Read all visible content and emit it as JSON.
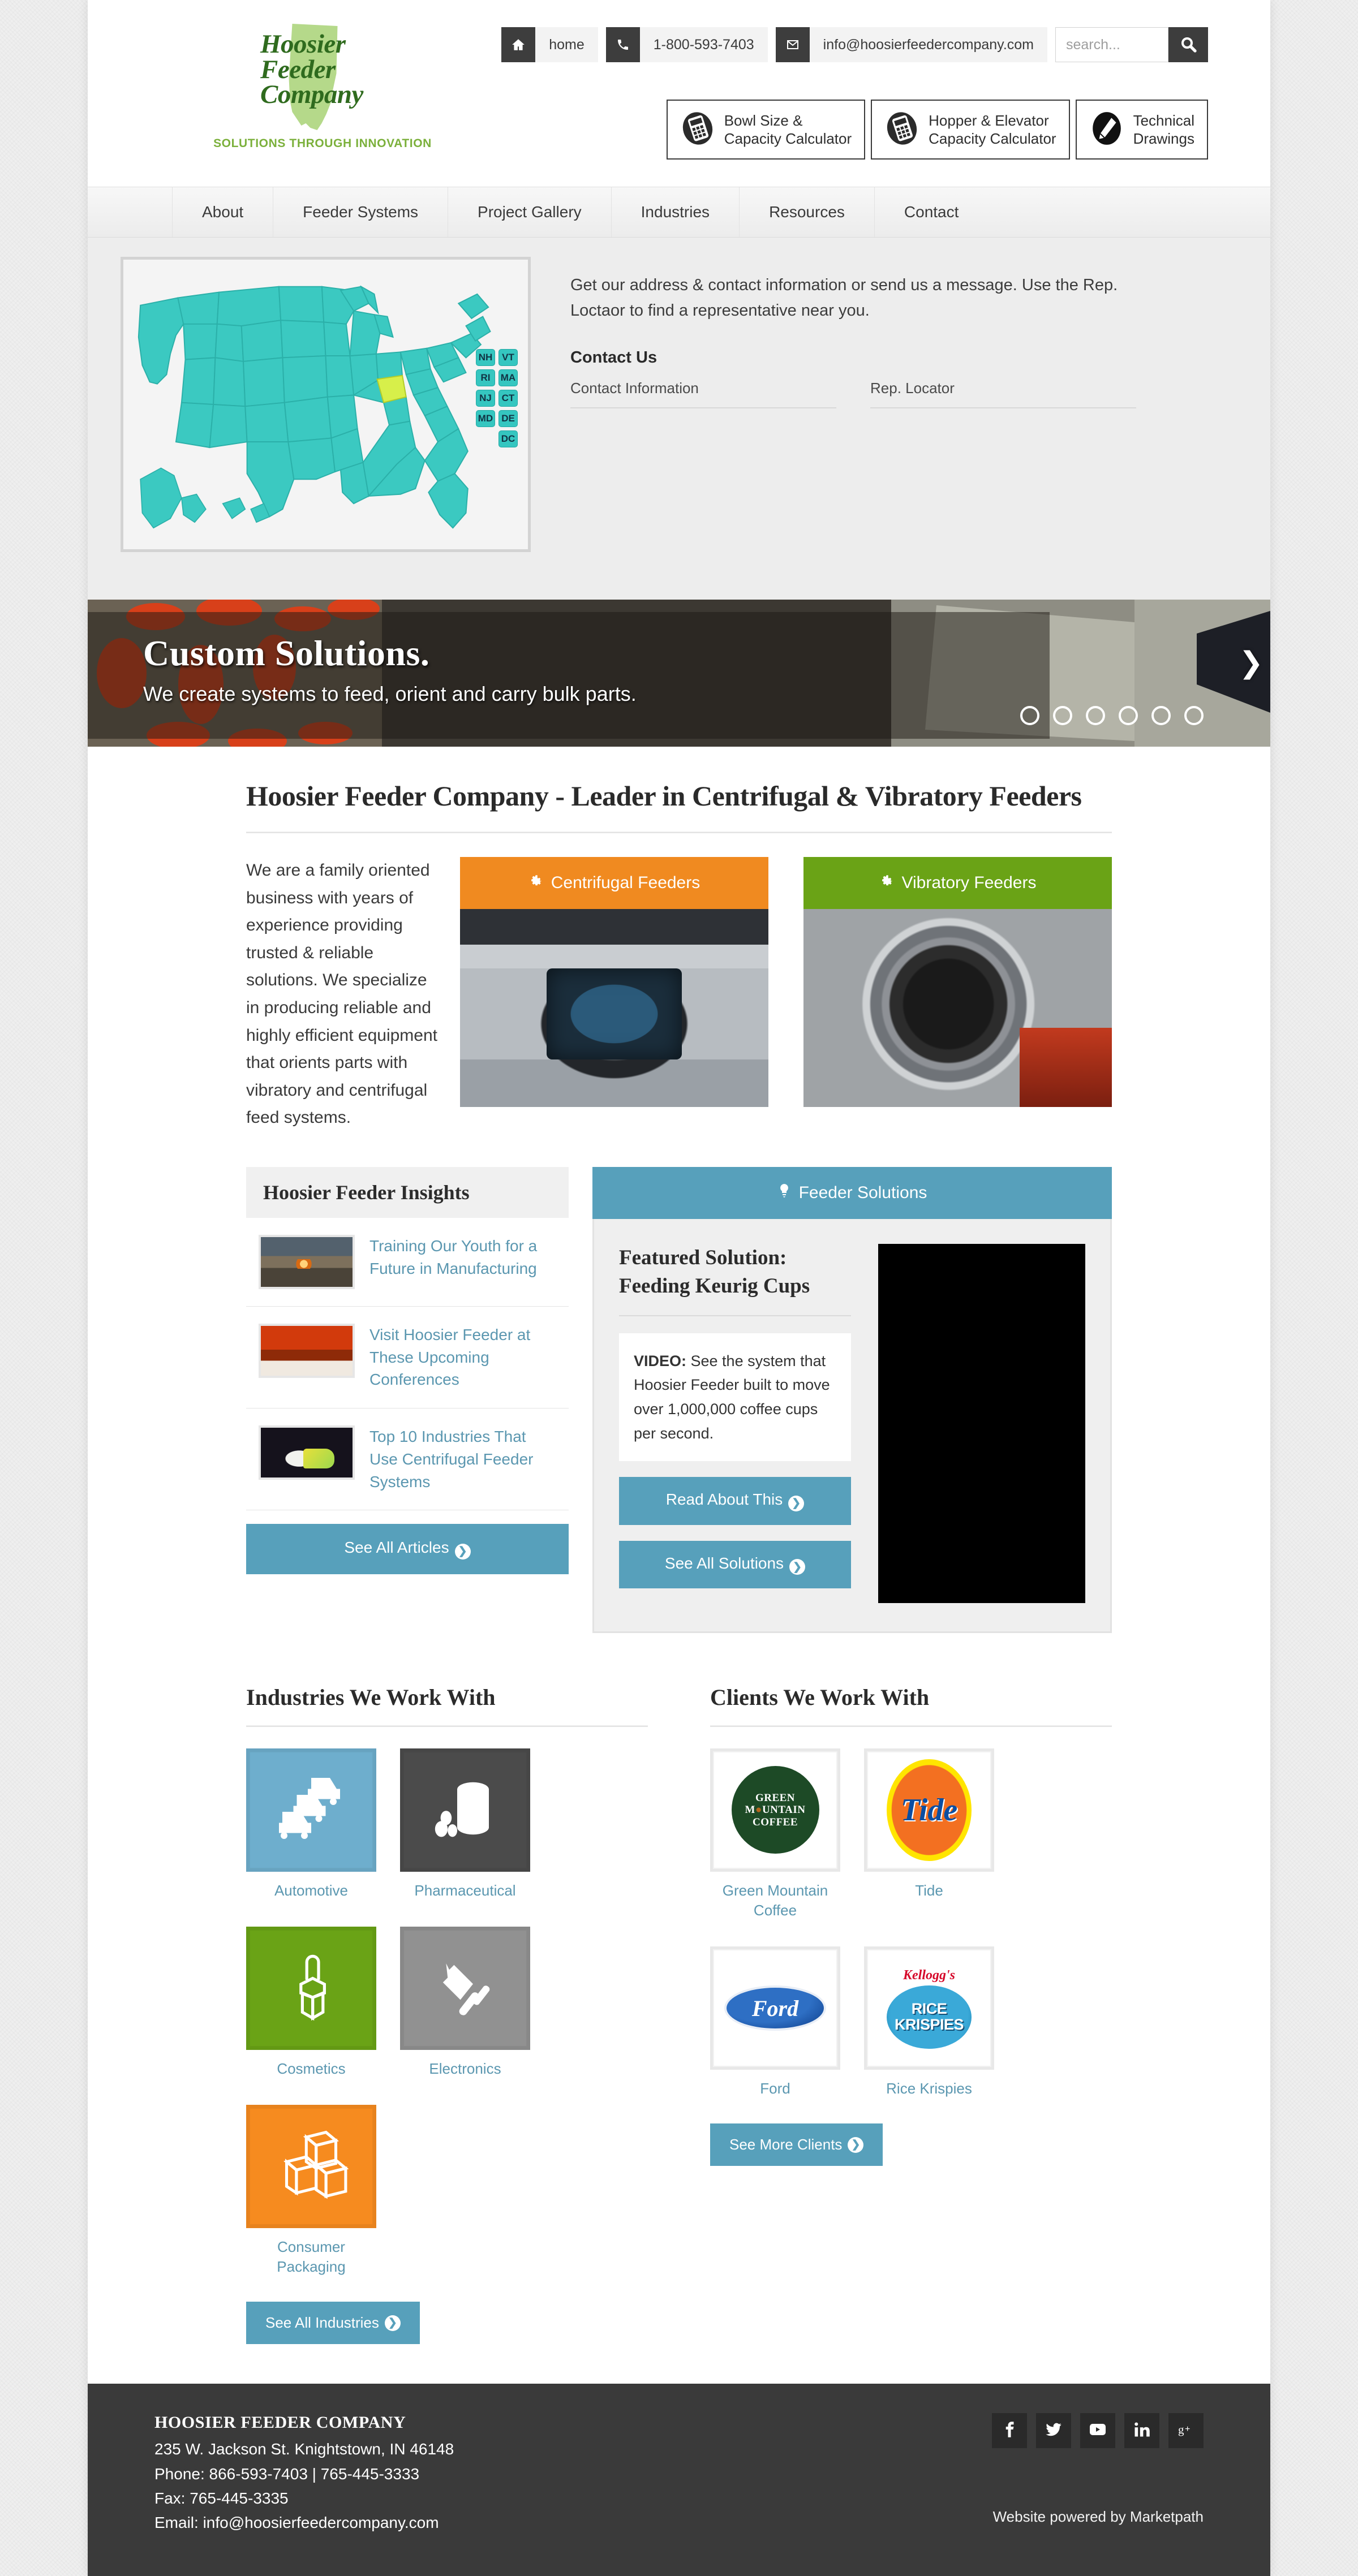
{
  "brand": {
    "name_lines": [
      "Hoosier",
      "Feeder",
      "Company"
    ],
    "tagline": "SOLUTIONS THROUGH INNOVATION",
    "accent_green": "#7bb03b",
    "accent_blue": "#57a0bb"
  },
  "topbar": {
    "home_label": "home",
    "phone": "1-800-593-7403",
    "email": "info@hoosierfeedercompany.com",
    "search_placeholder": "search..."
  },
  "tools": [
    {
      "line1": "Bowl Size &",
      "line2": "Capacity Calculator",
      "icon": "calculator-icon"
    },
    {
      "line1": "Hopper & Elevator",
      "line2": "Capacity Calculator",
      "icon": "calculator-icon"
    },
    {
      "line1": "Technical",
      "line2": "Drawings",
      "icon": "pencil-icon"
    }
  ],
  "nav": {
    "items": [
      "About",
      "Feeder Systems",
      "Project Gallery",
      "Industries",
      "Resources",
      "Contact"
    ]
  },
  "mega": {
    "lead": "Get our address & contact information or send us a message. Use the Rep. Loctaor to find a representative near you.",
    "heading": "Contact Us",
    "links": [
      "Contact Information",
      "Rep. Locator"
    ],
    "map": {
      "highlight_state": "Indiana",
      "map_fill": "#3bc9c1",
      "highlight_fill": "#d7ef4a",
      "chips_left": [
        "NH",
        "RI",
        "NJ",
        "MD"
      ],
      "chips_right": [
        "VT",
        "MA",
        "CT",
        "DE",
        "DC"
      ]
    }
  },
  "hero": {
    "title": "Custom Solutions.",
    "subtitle": "We create systems to feed, orient and carry bulk parts.",
    "slide_count": 6,
    "active_slide": 1
  },
  "main": {
    "page_title": "Hoosier Feeder Company - Leader in Centrifugal & Vibratory Feeders",
    "intro": "We are a family oriented business with years of experience providing trusted & reliable solutions. We specialize in producing reliable and highly efficient equipment that orients parts with vibratory and centrifugal feed systems.",
    "feeder_cards": [
      {
        "label": "Centrifugal Feeders",
        "color": "#f08a20",
        "icon": "gear-icon"
      },
      {
        "label": "Vibratory Feeders",
        "color": "#6aa316",
        "icon": "gear-icon"
      }
    ]
  },
  "insights": {
    "heading": "Hoosier Feeder Insights",
    "articles": [
      {
        "title": "Training Our Youth for a Future in Manufacturing"
      },
      {
        "title": "Visit Hoosier Feeder at These Upcoming Conferences"
      },
      {
        "title": "Top 10 Industries That Use Centrifugal Feeder Systems"
      }
    ],
    "see_all_label": "See All Articles"
  },
  "solutions": {
    "header": "Feeder Solutions",
    "header_icon": "lightbulb-icon",
    "title_line1": "Featured Solution:",
    "title_line2": "Feeding Keurig Cups",
    "note_label": "VIDEO:",
    "note_text": " See the system that Hoosier Feeder built to move over 1,000,000 coffee cups per second.",
    "read_label": "Read About This",
    "see_all_label": "See All Solutions"
  },
  "industries": {
    "heading": "Industries We Work With",
    "items": [
      {
        "label": "Automotive",
        "color": "blue",
        "icon": "cars-icon"
      },
      {
        "label": "Pharmaceutical",
        "color": "dark",
        "icon": "pill-bottle-icon"
      },
      {
        "label": "Cosmetics",
        "color": "green",
        "icon": "lipstick-icon"
      },
      {
        "label": "Electronics",
        "color": "gray",
        "icon": "plug-icon"
      },
      {
        "label": "Consumer Packaging",
        "color": "orange",
        "icon": "boxes-icon"
      }
    ],
    "button_label": "See All Industries"
  },
  "clients": {
    "heading": "Clients We Work With",
    "items": [
      {
        "label": "Green Mountain Coffee",
        "logo": "green-mountain-coffee-logo"
      },
      {
        "label": "Tide",
        "logo": "tide-logo"
      },
      {
        "label": "Ford",
        "logo": "ford-logo"
      },
      {
        "label": "Rice Krispies",
        "logo": "rice-krispies-logo"
      }
    ],
    "button_label": "See More Clients"
  },
  "footer": {
    "company": "HOOSIER FEEDER COMPANY",
    "address": "235 W. Jackson St. Knightstown, IN 46148",
    "phone": "Phone: 866-593-7403 | 765-445-3333",
    "fax": "Fax: 765-445-3335",
    "email": "Email: info@hoosierfeedercompany.com",
    "powered": "Website powered by Marketpath",
    "socials": [
      "facebook-icon",
      "twitter-icon",
      "youtube-icon",
      "linkedin-icon",
      "googleplus-icon"
    ]
  }
}
